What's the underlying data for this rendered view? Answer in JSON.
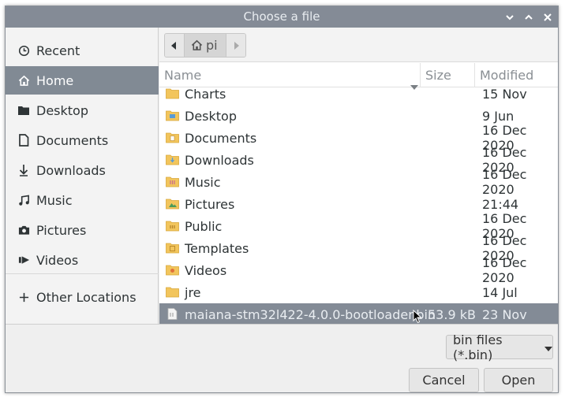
{
  "window": {
    "title": "Choose a file"
  },
  "sidebar": {
    "items": [
      {
        "label": "Recent",
        "icon": "clock-icon"
      },
      {
        "label": "Home",
        "icon": "home-icon",
        "active": true
      },
      {
        "label": "Desktop",
        "icon": "folder-icon"
      },
      {
        "label": "Documents",
        "icon": "document-icon"
      },
      {
        "label": "Downloads",
        "icon": "download-icon"
      },
      {
        "label": "Music",
        "icon": "music-icon"
      },
      {
        "label": "Pictures",
        "icon": "camera-icon"
      },
      {
        "label": "Videos",
        "icon": "video-icon"
      }
    ],
    "other": {
      "label": "Other Locations",
      "icon": "plus-icon"
    }
  },
  "pathbar": {
    "current": "pi"
  },
  "columns": {
    "name": "Name",
    "size": "Size",
    "modified": "Modified"
  },
  "files": [
    {
      "name": "Charts",
      "size": "",
      "modified": "15 Nov",
      "icon": "folder-icon"
    },
    {
      "name": "Desktop",
      "size": "",
      "modified": "9 Jun",
      "icon": "folder-desktop-icon"
    },
    {
      "name": "Documents",
      "size": "",
      "modified": "16 Dec 2020",
      "icon": "folder-documents-icon"
    },
    {
      "name": "Downloads",
      "size": "",
      "modified": "16 Dec 2020",
      "icon": "folder-downloads-icon"
    },
    {
      "name": "Music",
      "size": "",
      "modified": "16 Dec 2020",
      "icon": "folder-music-icon"
    },
    {
      "name": "Pictures",
      "size": "",
      "modified": "21:44",
      "icon": "folder-pictures-icon"
    },
    {
      "name": "Public",
      "size": "",
      "modified": "16 Dec 2020",
      "icon": "folder-public-icon"
    },
    {
      "name": "Templates",
      "size": "",
      "modified": "16 Dec 2020",
      "icon": "folder-templates-icon"
    },
    {
      "name": "Videos",
      "size": "",
      "modified": "16 Dec 2020",
      "icon": "folder-videos-icon"
    },
    {
      "name": "jre",
      "size": "",
      "modified": "14 Jul",
      "icon": "folder-icon"
    },
    {
      "name": "maiana-stm32l422-4.0.0-bootloader.bin",
      "size": "53.9 kB",
      "modified": "23 Nov",
      "icon": "binary-file-icon",
      "selected": true
    }
  ],
  "footer": {
    "filter": "bin files (*.bin)",
    "cancel": "Cancel",
    "open": "Open"
  },
  "colors": {
    "titlebar": "#848b96",
    "selection": "#838b96",
    "folder": "#f2c55c"
  }
}
